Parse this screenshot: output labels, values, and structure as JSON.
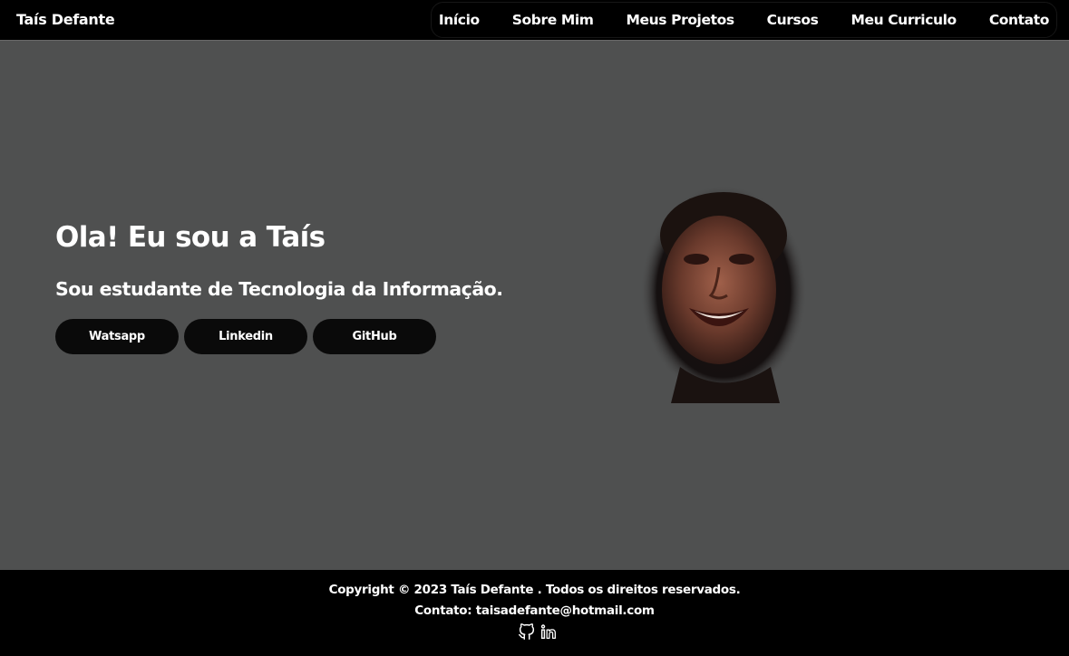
{
  "header": {
    "brand": "Taís Defante",
    "nav": [
      "Início",
      "Sobre Mim",
      "Meus Projetos",
      "Cursos",
      "Meu Curriculo",
      "Contato"
    ]
  },
  "hero": {
    "title": "Ola! Eu sou a Taís",
    "subtitle": "Sou estudante de Tecnologia da Informação.",
    "buttons": [
      "Watsapp",
      "Linkedin",
      "GitHub"
    ]
  },
  "footer": {
    "copyright": "Copyright © 2023 Taís Defante . Todos os direitos reservados.",
    "contact": "Contato: taisadefante@hotmail.com",
    "icons": [
      "github-icon",
      "linkedin-icon"
    ]
  },
  "colors": {
    "page_bg": "#4f5050",
    "bar_bg": "#000000",
    "button_bg": "#0a0a0a",
    "text": "#ffffff"
  }
}
